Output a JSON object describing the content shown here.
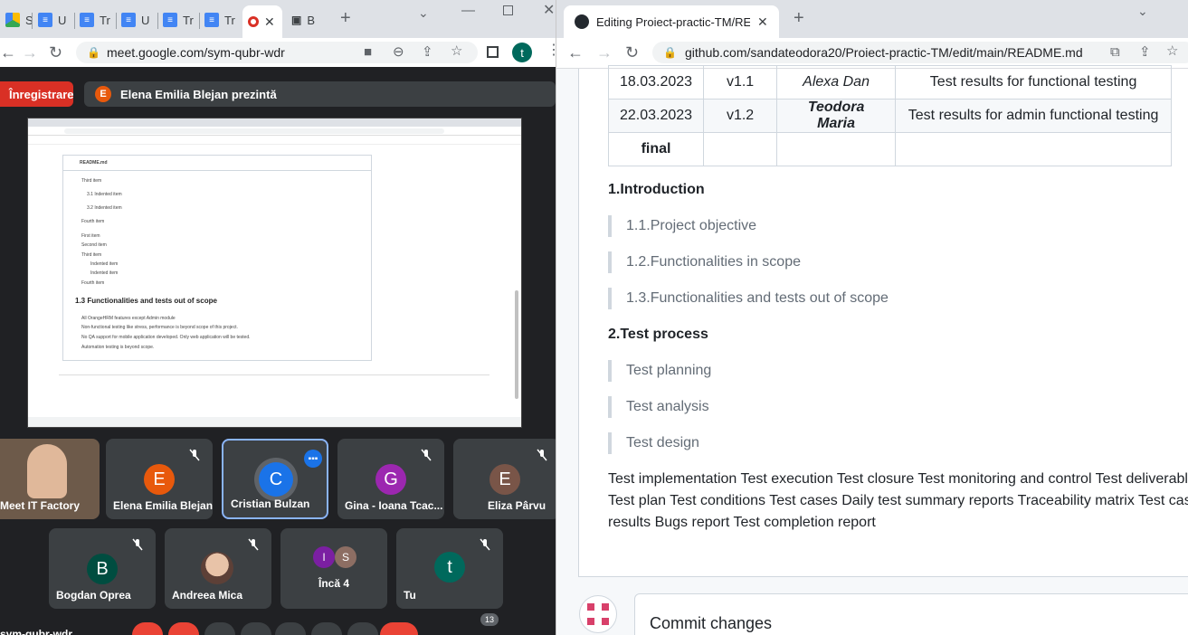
{
  "left": {
    "tabs": [
      {
        "label": "S"
      },
      {
        "label": "U"
      },
      {
        "label": "Tr"
      },
      {
        "label": "U"
      },
      {
        "label": "Tr"
      },
      {
        "label": "Tr"
      },
      {
        "label": "B"
      }
    ],
    "url": "meet.google.com/sym-qubr-wdr",
    "profile_initial": "t",
    "recording_label": "Înregistrare",
    "presenter_initial": "E",
    "presenter_text": "Elena Emilia Blejan prezintă",
    "shared_screen": {
      "file": "README.md",
      "list1": [
        "Third item",
        "3.1 Indented item",
        "3.2 Indented item",
        "Fourth item"
      ],
      "list2": [
        "First item",
        "Second item",
        "Third item",
        "Indented item",
        "Indented item",
        "Fourth item"
      ],
      "heading": "1.3 Functionalities and tests out of scope",
      "list3": [
        "All OrangeHRM features except Admin module",
        "Non-functional testing like stress, performance is beyond scope of this project.",
        "No QA support for mobile application developed. Only web application will be tested.",
        "Automation testing is beyond scope."
      ]
    },
    "participants": [
      {
        "name": "Meet IT Factory",
        "initial": "",
        "color": "#8d6e63"
      },
      {
        "name": "Elena Emilia Blejan",
        "initial": "E",
        "color": "#e8590c"
      },
      {
        "name": "Cristian Bulzan",
        "initial": "C",
        "color": "#1a73e8"
      },
      {
        "name": "Gina - Ioana Tcac...",
        "initial": "G",
        "color": "#9c27b0"
      },
      {
        "name": "Eliza Pârvu",
        "initial": "E",
        "color": "#795548"
      },
      {
        "name": "Bogdan Oprea",
        "initial": "B",
        "color": "#004d40"
      },
      {
        "name": "Andreea Mica",
        "initial": "",
        "color": "#a1887f"
      },
      {
        "name": "Încă 4",
        "initial": "",
        "color": ""
      },
      {
        "name": "Tu",
        "initial": "t",
        "color": "#00695c"
      }
    ],
    "more_avatars": [
      {
        "initial": "I",
        "color": "#7b1fa2"
      },
      {
        "initial": "S",
        "color": "#8d6e63"
      }
    ],
    "meeting_code": "sym-qubr-wdr",
    "people_count": "13"
  },
  "right": {
    "tab_title": "Editing Proiect-practic-TM/READ",
    "url": "github.com/sandateodora20/Proiect-practic-TM/edit/main/README.md",
    "table_rows": [
      {
        "date": "18.03.2023",
        "version": "v1.1",
        "author": "Alexa Dan",
        "desc": "Test results for functional testing",
        "author_bold": false
      },
      {
        "date": "22.03.2023",
        "version": "v1.2",
        "author": "Teodora Maria",
        "desc": "Test results for admin functional testing",
        "author_bold": true
      },
      {
        "date": "final",
        "version": "",
        "author": "",
        "desc": "",
        "author_bold": false
      }
    ],
    "section1": "1.Introduction",
    "section1_items": [
      "1.1.Project objective",
      "1.2.Functionalities in scope",
      "1.3.Functionalities and tests out of scope"
    ],
    "section2": "2.Test process",
    "section2_items": [
      "Test planning",
      "Test analysis",
      "Test design"
    ],
    "paragraph": "Test implementation Test execution Test closure Test monitoring and control Test deliverables Test plan Test conditions Test cases Daily test summary reports Traceability matrix Test case results Bugs report Test completion report",
    "commit_title": "Commit changes"
  }
}
